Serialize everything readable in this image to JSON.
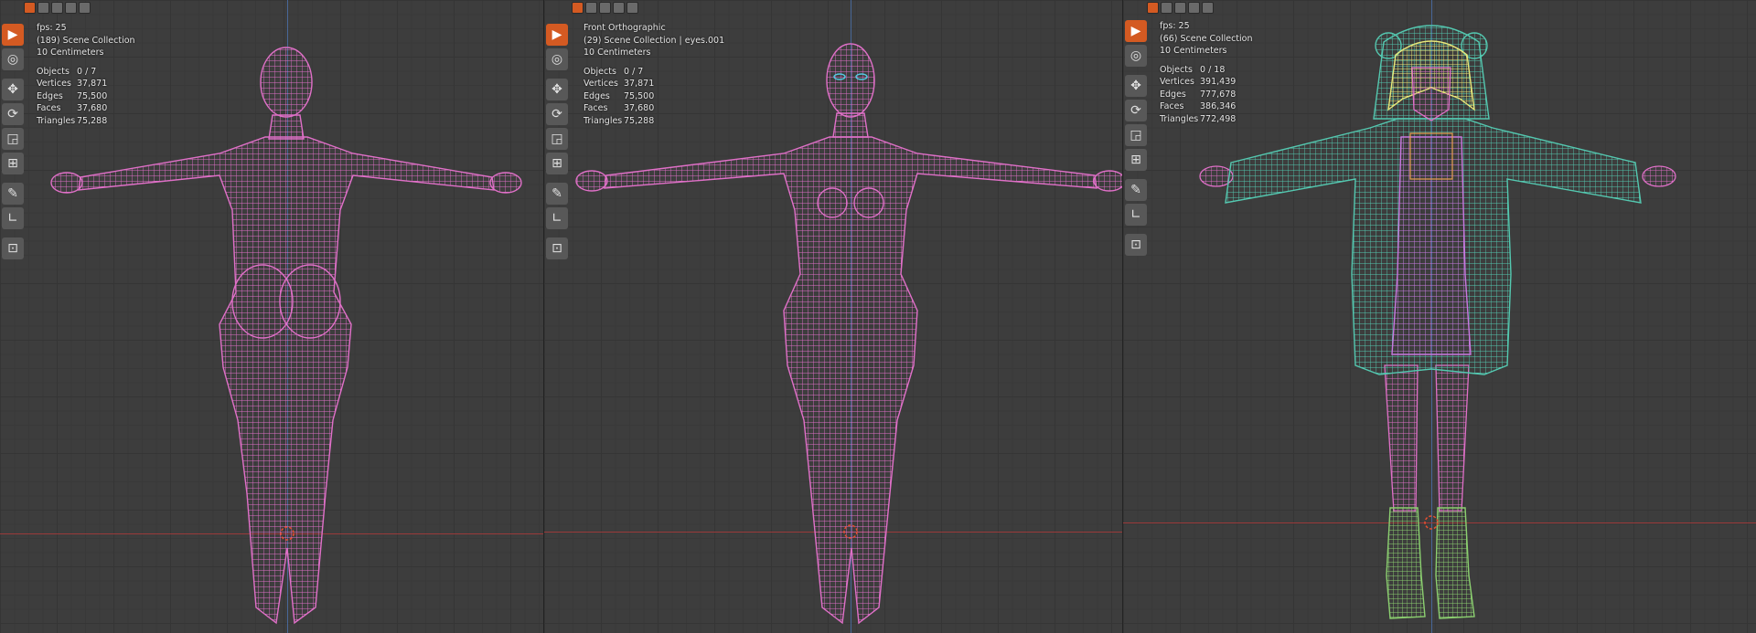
{
  "panels": [
    {
      "line1": "fps: 25",
      "line2": "(189) Scene Collection",
      "line3": "10 Centimeters",
      "stats": [
        {
          "label": "Objects",
          "value": "0 / 7"
        },
        {
          "label": "Vertices",
          "value": "37,871"
        },
        {
          "label": "Edges",
          "value": "75,500"
        },
        {
          "label": "Faces",
          "value": "37,680"
        },
        {
          "label": "Triangles",
          "value": "75,288"
        }
      ]
    },
    {
      "line1": "Front Orthographic",
      "line2": "(29) Scene Collection | eyes.001",
      "line3": "10 Centimeters",
      "stats": [
        {
          "label": "Objects",
          "value": "0 / 7"
        },
        {
          "label": "Vertices",
          "value": "37,871"
        },
        {
          "label": "Edges",
          "value": "75,500"
        },
        {
          "label": "Faces",
          "value": "37,680"
        },
        {
          "label": "Triangles",
          "value": "75,288"
        }
      ]
    },
    {
      "line1": "fps: 25",
      "line2": "(66) Scene Collection",
      "line3": "10 Centimeters",
      "stats": [
        {
          "label": "Objects",
          "value": "0 / 18"
        },
        {
          "label": "Vertices",
          "value": "391,439"
        },
        {
          "label": "Edges",
          "value": "777,678"
        },
        {
          "label": "Faces",
          "value": "386,346"
        },
        {
          "label": "Triangles",
          "value": "772,498"
        }
      ]
    }
  ],
  "tools": [
    "select-box-icon",
    "cursor-icon",
    "move-icon",
    "rotate-icon",
    "scale-icon",
    "transform-icon",
    "annotate-icon",
    "measure-icon",
    "add-cube-icon"
  ],
  "colors": {
    "wire_body": "#e070c8",
    "wire_hoodie": "#54c8b0",
    "wire_hair": "#e8e87a",
    "wire_boots": "#8cd070",
    "wire_dress": "#c878e0",
    "accent_active": "#d45a22",
    "axis_x": "#9a3a3a",
    "axis_y": "#4a6ea8"
  }
}
